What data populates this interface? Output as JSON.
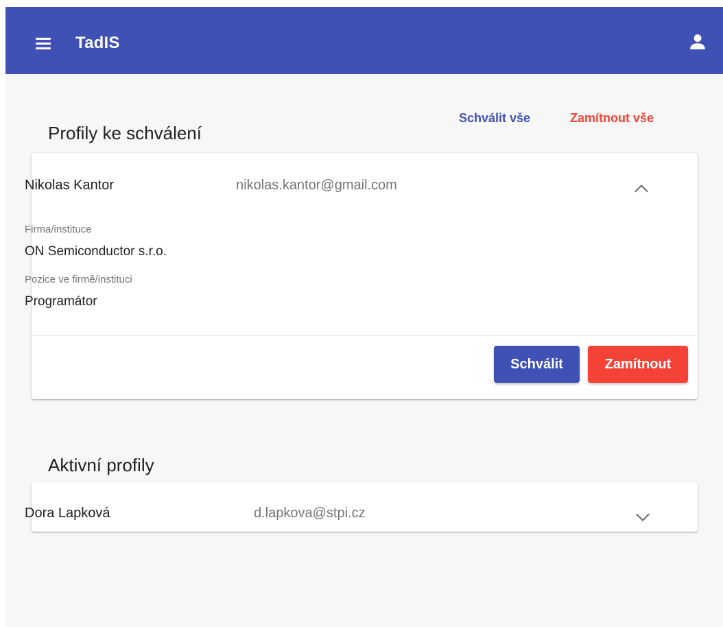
{
  "app_bar": {
    "title": "TadIS",
    "menu_icon": "menu-icon",
    "account_icon": "account-icon",
    "color": "#3f51b5"
  },
  "pending": {
    "title": "Profily ke schválení",
    "approve_all_label": "Schválit vše",
    "reject_all_label": "Zamítnout vše",
    "profile": {
      "name": "Nikolas Kantor",
      "email": "nikolas.kantor@gmail.com",
      "expanded": true,
      "details": [
        {
          "label": "Firma/instituce",
          "value": "ON Semiconductor s.r.o."
        },
        {
          "label": "Pozice ve firmě/instituci",
          "value": "Programátor"
        }
      ],
      "approve_label": "Schválit",
      "reject_label": "Zamítnout"
    }
  },
  "active": {
    "title": "Aktivní profily",
    "profiles": [
      {
        "name": "Dora Lapková",
        "email": "d.lapkova@stpi.cz",
        "expanded": false
      }
    ]
  },
  "colors": {
    "primary": "#3f51b5",
    "danger": "#f44336",
    "background": "#f7f7f7"
  }
}
